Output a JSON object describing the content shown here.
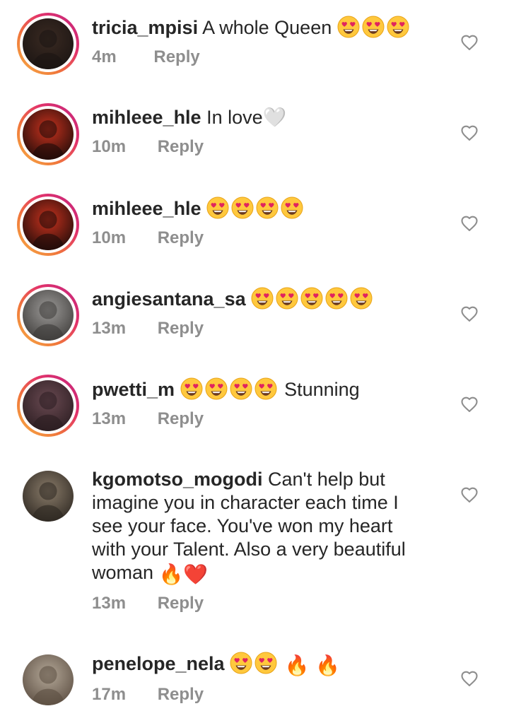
{
  "comments": [
    {
      "username": "tricia_mpisi",
      "text_before": "A whole Queen",
      "heart_eyes": 3,
      "text_after": "",
      "trailing": "",
      "time": "4m",
      "reply": "Reply",
      "story_ring": true,
      "avatar_colors": [
        "#3a2a22",
        "#1a1412"
      ]
    },
    {
      "username": "mihleee_hle",
      "text_before": "In love🤍",
      "heart_eyes": 0,
      "text_after": "",
      "trailing": "",
      "time": "10m",
      "reply": "Reply",
      "story_ring": true,
      "avatar_colors": [
        "#c8321e",
        "#1a0a08"
      ]
    },
    {
      "username": "mihleee_hle",
      "text_before": "",
      "heart_eyes": 4,
      "text_after": "",
      "trailing": "",
      "time": "10m",
      "reply": "Reply",
      "story_ring": true,
      "avatar_colors": [
        "#c8321e",
        "#1a0a08"
      ]
    },
    {
      "username": "angiesantana_sa",
      "text_before": "",
      "heart_eyes": 5,
      "text_after": "",
      "trailing": "",
      "time": "13m",
      "reply": "Reply",
      "story_ring": true,
      "avatar_colors": [
        "#9c9a98",
        "#3c3a38"
      ]
    },
    {
      "username": "pwetti_m",
      "text_before": "",
      "heart_eyes": 4,
      "text_after": "Stunning",
      "trailing": "",
      "time": "13m",
      "reply": "Reply",
      "story_ring": true,
      "avatar_colors": [
        "#6a4a52",
        "#2a1c20"
      ]
    },
    {
      "username": "kgomotso_mogodi",
      "text_before": "Can't help but imagine you in character each time I see your face. You've won my heart with your Talent. Also a very beautiful woman",
      "heart_eyes": 0,
      "text_after": "",
      "trailing": "🔥❤️",
      "time": "13m",
      "reply": "Reply",
      "story_ring": false,
      "avatar_colors": [
        "#8a7c6a",
        "#2c2620"
      ]
    },
    {
      "username": "penelope_nela",
      "text_before": "",
      "heart_eyes": 2,
      "text_after": "",
      "trailing": "🔥 🔥",
      "time": "17m",
      "reply": "Reply",
      "story_ring": false,
      "avatar_colors": [
        "#b4a898",
        "#5a4c40"
      ]
    }
  ],
  "colors": {
    "text": "#262626",
    "muted": "#8e8e8e",
    "like_outline": "#8e8e8e",
    "story_ring_start": "#f7b046",
    "story_ring_end": "#c0237f"
  },
  "icons": {
    "like": "heart-outline-icon",
    "emoji": "smiling-face-with-heart-eyes"
  }
}
